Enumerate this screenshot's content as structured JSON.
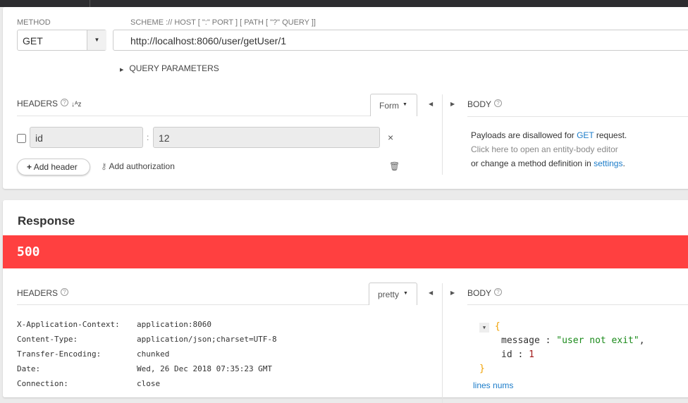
{
  "request": {
    "method_label": "METHOD",
    "method": "GET",
    "url_label": "SCHEME :// HOST [ \":\" PORT ] [ PATH [ \"?\" QUERY ]]",
    "url": "http://localhost:8060/user/getUser/1",
    "query_params": "QUERY PARAMETERS",
    "headers_label": "HEADERS",
    "form_label": "Form",
    "header_rows": [
      {
        "name": "id",
        "value": "12",
        "enabled": false
      }
    ],
    "add_header": "Add header",
    "add_authorization": "Add authorization",
    "body_label": "BODY",
    "body_msg1a": "Payloads are disallowed for ",
    "body_msg1b": "GET",
    "body_msg1c": " request.",
    "body_msg2": "Click here to open an entity-body editor",
    "body_msg3a": "or change a method definition in ",
    "body_msg3b": "settings",
    "body_msg3c": "."
  },
  "response": {
    "title": "Response",
    "status": "500",
    "status_color": "#ff4040",
    "headers_label": "HEADERS",
    "pretty_label": "pretty",
    "body_label": "BODY",
    "headers": [
      {
        "k": "X-Application-Context:",
        "v": "application:8060"
      },
      {
        "k": "Content-Type:",
        "v": "application/json;charset=UTF-8"
      },
      {
        "k": "Transfer-Encoding:",
        "v": "chunked"
      },
      {
        "k": "Date:",
        "v": "Wed, 26 Dec 2018 07:35:23 GMT"
      },
      {
        "k": "Connection:",
        "v": "close"
      }
    ],
    "body": {
      "open": "{",
      "close": "}",
      "k1": "message",
      "v1": "\"user not exit\"",
      "k2": "id",
      "v2": "1"
    },
    "lines_nums": "lines nums"
  }
}
